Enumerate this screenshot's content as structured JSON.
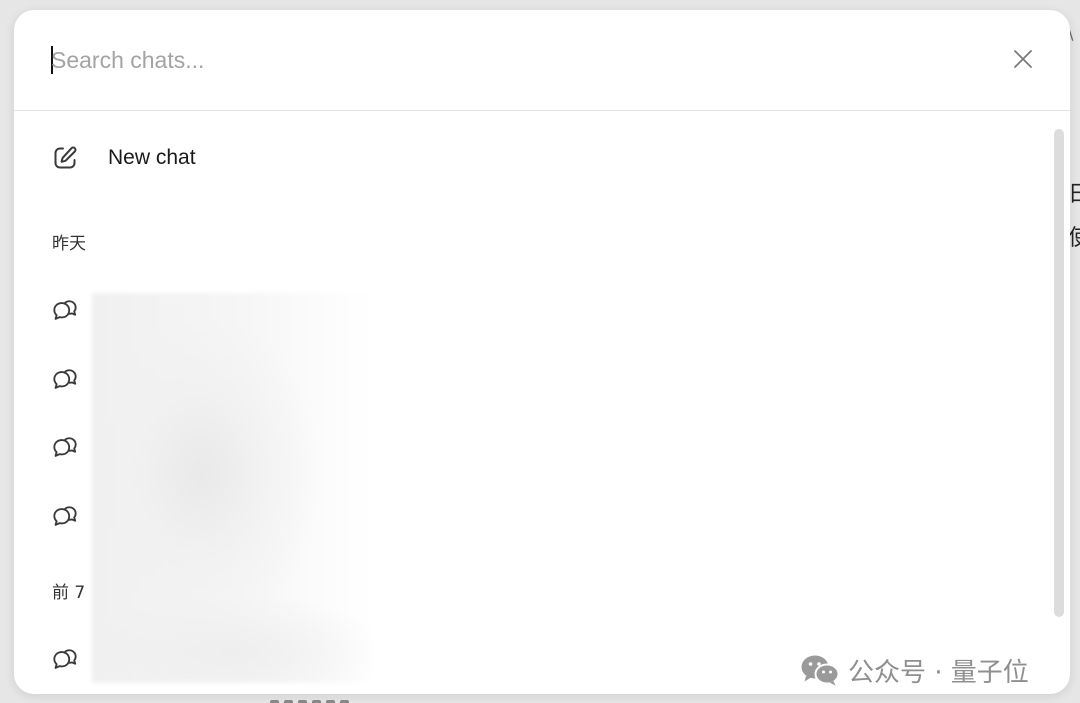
{
  "search": {
    "placeholder": "Search chats...",
    "value": ""
  },
  "menu": {
    "new_chat_label": "New chat"
  },
  "sections": [
    {
      "label": "昨天"
    },
    {
      "label": "前 7"
    }
  ],
  "chats": [
    {
      "title": ""
    },
    {
      "title": ""
    },
    {
      "title": ""
    },
    {
      "title": ""
    },
    {
      "title": ""
    }
  ],
  "watermark": {
    "text": "公众号 · 量子位"
  },
  "background_fragments": [
    "\\",
    "日",
    "使"
  ],
  "icons": {
    "close": "close-icon",
    "new_chat": "pencil-square-icon",
    "chat": "chat-bubbles-icon",
    "watermark_logo": "wechat-logo"
  },
  "colors": {
    "modal_bg": "#ffffff",
    "placeholder": "#a3a3a3",
    "text": "#1a1a1a",
    "watermark": "#8f8f8f",
    "scrollbar": "#dcdcdc"
  }
}
